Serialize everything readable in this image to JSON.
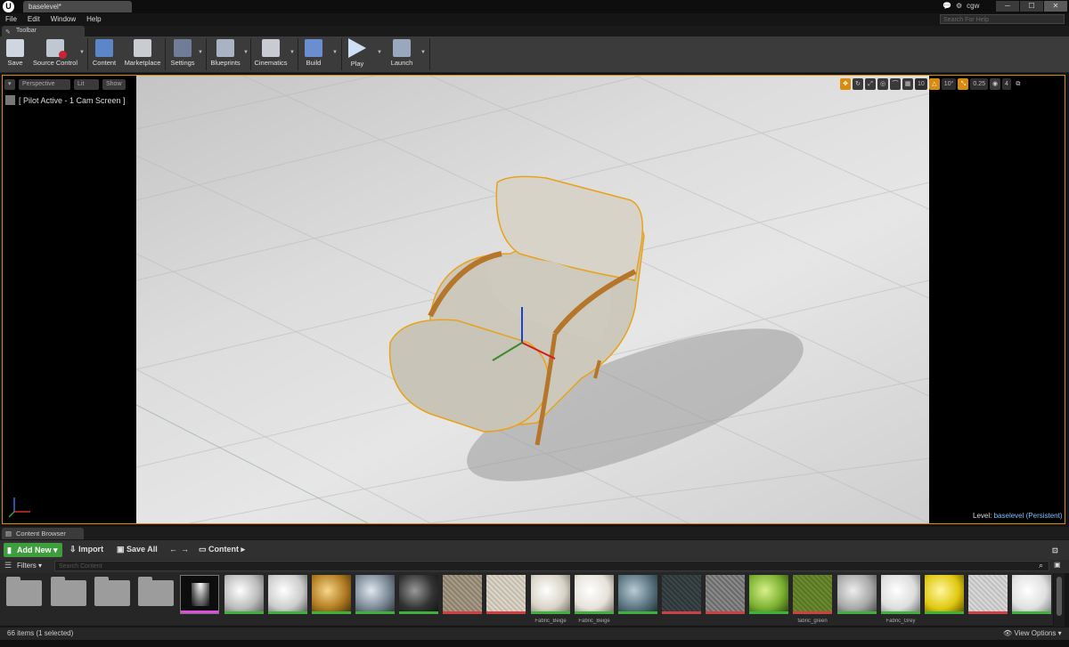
{
  "window": {
    "tab_title": "baselevel*",
    "account": "cgw",
    "help_search_placeholder": "Search For Help"
  },
  "menu": [
    "File",
    "Edit",
    "Window",
    "Help"
  ],
  "toolbar": {
    "tab_label": "Toolbar",
    "buttons": [
      {
        "label": "Save",
        "icon": "save-icon"
      },
      {
        "label": "Source Control",
        "icon": "source-control-icon"
      },
      {
        "label": "Content",
        "icon": "content-icon"
      },
      {
        "label": "Marketplace",
        "icon": "marketplace-icon"
      },
      {
        "label": "Settings",
        "icon": "settings-icon"
      },
      {
        "label": "Blueprints",
        "icon": "blueprints-icon"
      },
      {
        "label": "Cinematics",
        "icon": "cinematics-icon"
      },
      {
        "label": "Build",
        "icon": "build-icon"
      },
      {
        "label": "Play",
        "icon": "play-icon"
      },
      {
        "label": "Launch",
        "icon": "launch-icon"
      }
    ]
  },
  "viewport": {
    "view_mode": "Perspective",
    "lighting": "Lit",
    "show": "Show",
    "pilot_text": "[ Pilot Active - 1 Cam Screen ]",
    "grid_snap": "10",
    "rotation_snap": "10°",
    "scale_snap": "0.25",
    "camera_speed": "4",
    "level_label": "Level:",
    "level_name": "baselevel (Persistent)"
  },
  "content_browser": {
    "tab_label": "Content Browser",
    "add_new": "Add New",
    "import": "Import",
    "save_all": "Save All",
    "path": "Content",
    "filters": "Filters",
    "search_placeholder": "Search Content",
    "status": "66 items (1 selected)",
    "view_options": "View Options",
    "thumb_labels": {
      "t11": "Fabric_Beige",
      "t12": "Fabric_Beige",
      "t17": "fabric_green",
      "t19": "Fabric_Grey"
    }
  },
  "colors": {
    "accent": "#d98b10",
    "add_new": "#3e9e3e",
    "level_link": "#7fbfff"
  }
}
